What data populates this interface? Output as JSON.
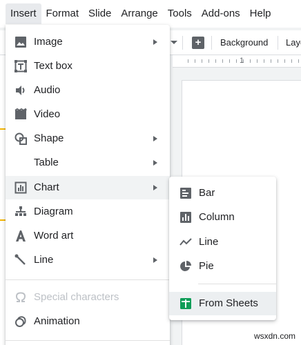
{
  "menubar": {
    "items": [
      {
        "label": "Insert"
      },
      {
        "label": "Format"
      },
      {
        "label": "Slide"
      },
      {
        "label": "Arrange"
      },
      {
        "label": "Tools"
      },
      {
        "label": "Add-ons"
      },
      {
        "label": "Help"
      }
    ]
  },
  "toolbar": {
    "background_label": "Background",
    "layout_label": "Layo"
  },
  "ruler": {
    "number": "1"
  },
  "insert_menu": {
    "items": [
      {
        "label": "Image",
        "icon": "image-icon",
        "has_submenu": true
      },
      {
        "label": "Text box",
        "icon": "text-box-icon",
        "has_submenu": false
      },
      {
        "label": "Audio",
        "icon": "audio-icon",
        "has_submenu": false
      },
      {
        "label": "Video",
        "icon": "video-icon",
        "has_submenu": false
      },
      {
        "label": "Shape",
        "icon": "shape-icon",
        "has_submenu": true
      },
      {
        "label": "Table",
        "icon": "",
        "has_submenu": true
      },
      {
        "label": "Chart",
        "icon": "chart-icon",
        "has_submenu": true,
        "highlighted": true
      },
      {
        "label": "Diagram",
        "icon": "diagram-icon",
        "has_submenu": false
      },
      {
        "label": "Word art",
        "icon": "word-art-icon",
        "has_submenu": false
      },
      {
        "label": "Line",
        "icon": "line-icon",
        "has_submenu": true
      },
      {
        "label": "Special characters",
        "icon": "omega-icon",
        "has_submenu": false,
        "disabled": true
      },
      {
        "label": "Animation",
        "icon": "animation-icon",
        "has_submenu": false
      }
    ]
  },
  "chart_submenu": {
    "items": [
      {
        "label": "Bar",
        "icon": "bar-chart-icon"
      },
      {
        "label": "Column",
        "icon": "column-chart-icon"
      },
      {
        "label": "Line",
        "icon": "line-chart-icon"
      },
      {
        "label": "Pie",
        "icon": "pie-chart-icon"
      },
      {
        "label": "From Sheets",
        "icon": "sheets-icon",
        "highlighted": true
      }
    ]
  },
  "watermark": "wsxdn.com",
  "colors": {
    "menu_background": "#ffffff",
    "highlight": "#f1f3f4",
    "icon_gray": "#5f6368",
    "sheets_green": "#0f9d58",
    "disabled_text": "#bdc1c6",
    "accent_yellow": "#f4b400"
  }
}
